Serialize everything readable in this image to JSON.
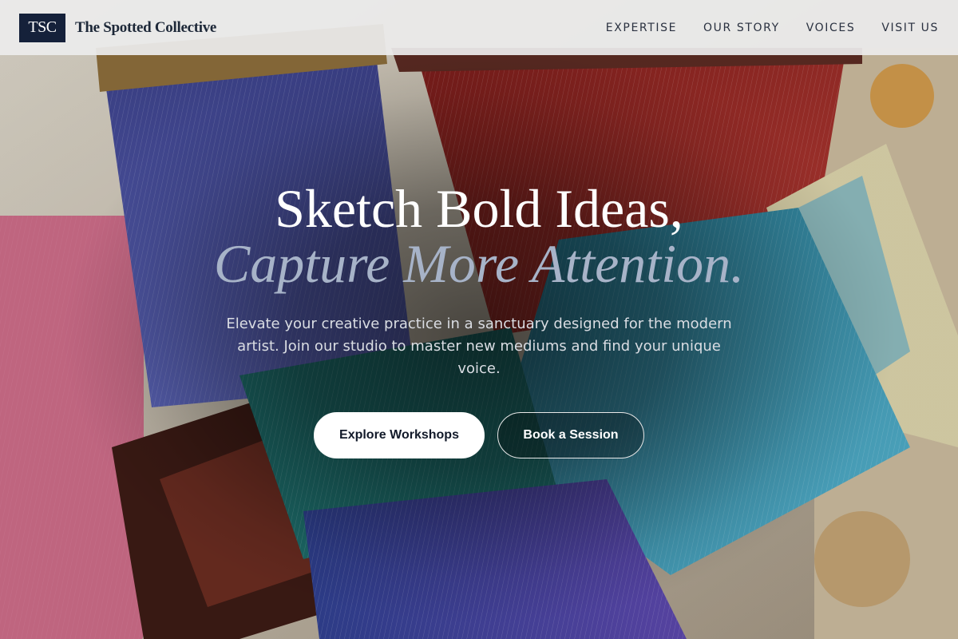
{
  "header": {
    "logo_text": "TSC",
    "brand_name": "The Spotted Collective",
    "nav": [
      {
        "label": "EXPERTISE"
      },
      {
        "label": "OUR STORY"
      },
      {
        "label": "VOICES"
      },
      {
        "label": "VISIT US"
      }
    ]
  },
  "hero": {
    "headline_line1": "Sketch Bold Ideas,",
    "headline_line2": "Capture More Attention.",
    "subtext": "Elevate your creative practice in a sanctuary designed for the modern artist. Join our studio to master new mediums and find your unique voice.",
    "primary_cta": "Explore Workshops",
    "secondary_cta": "Book a Session",
    "background_image": "paint-brushes-photo"
  },
  "colors": {
    "header_bg": "#ececec",
    "logo_bg": "#15213a",
    "headline_white": "#ffffff",
    "headline_accent": "#a7b3c8",
    "button_primary_bg": "#ffffff",
    "button_primary_text": "#121a2a"
  }
}
